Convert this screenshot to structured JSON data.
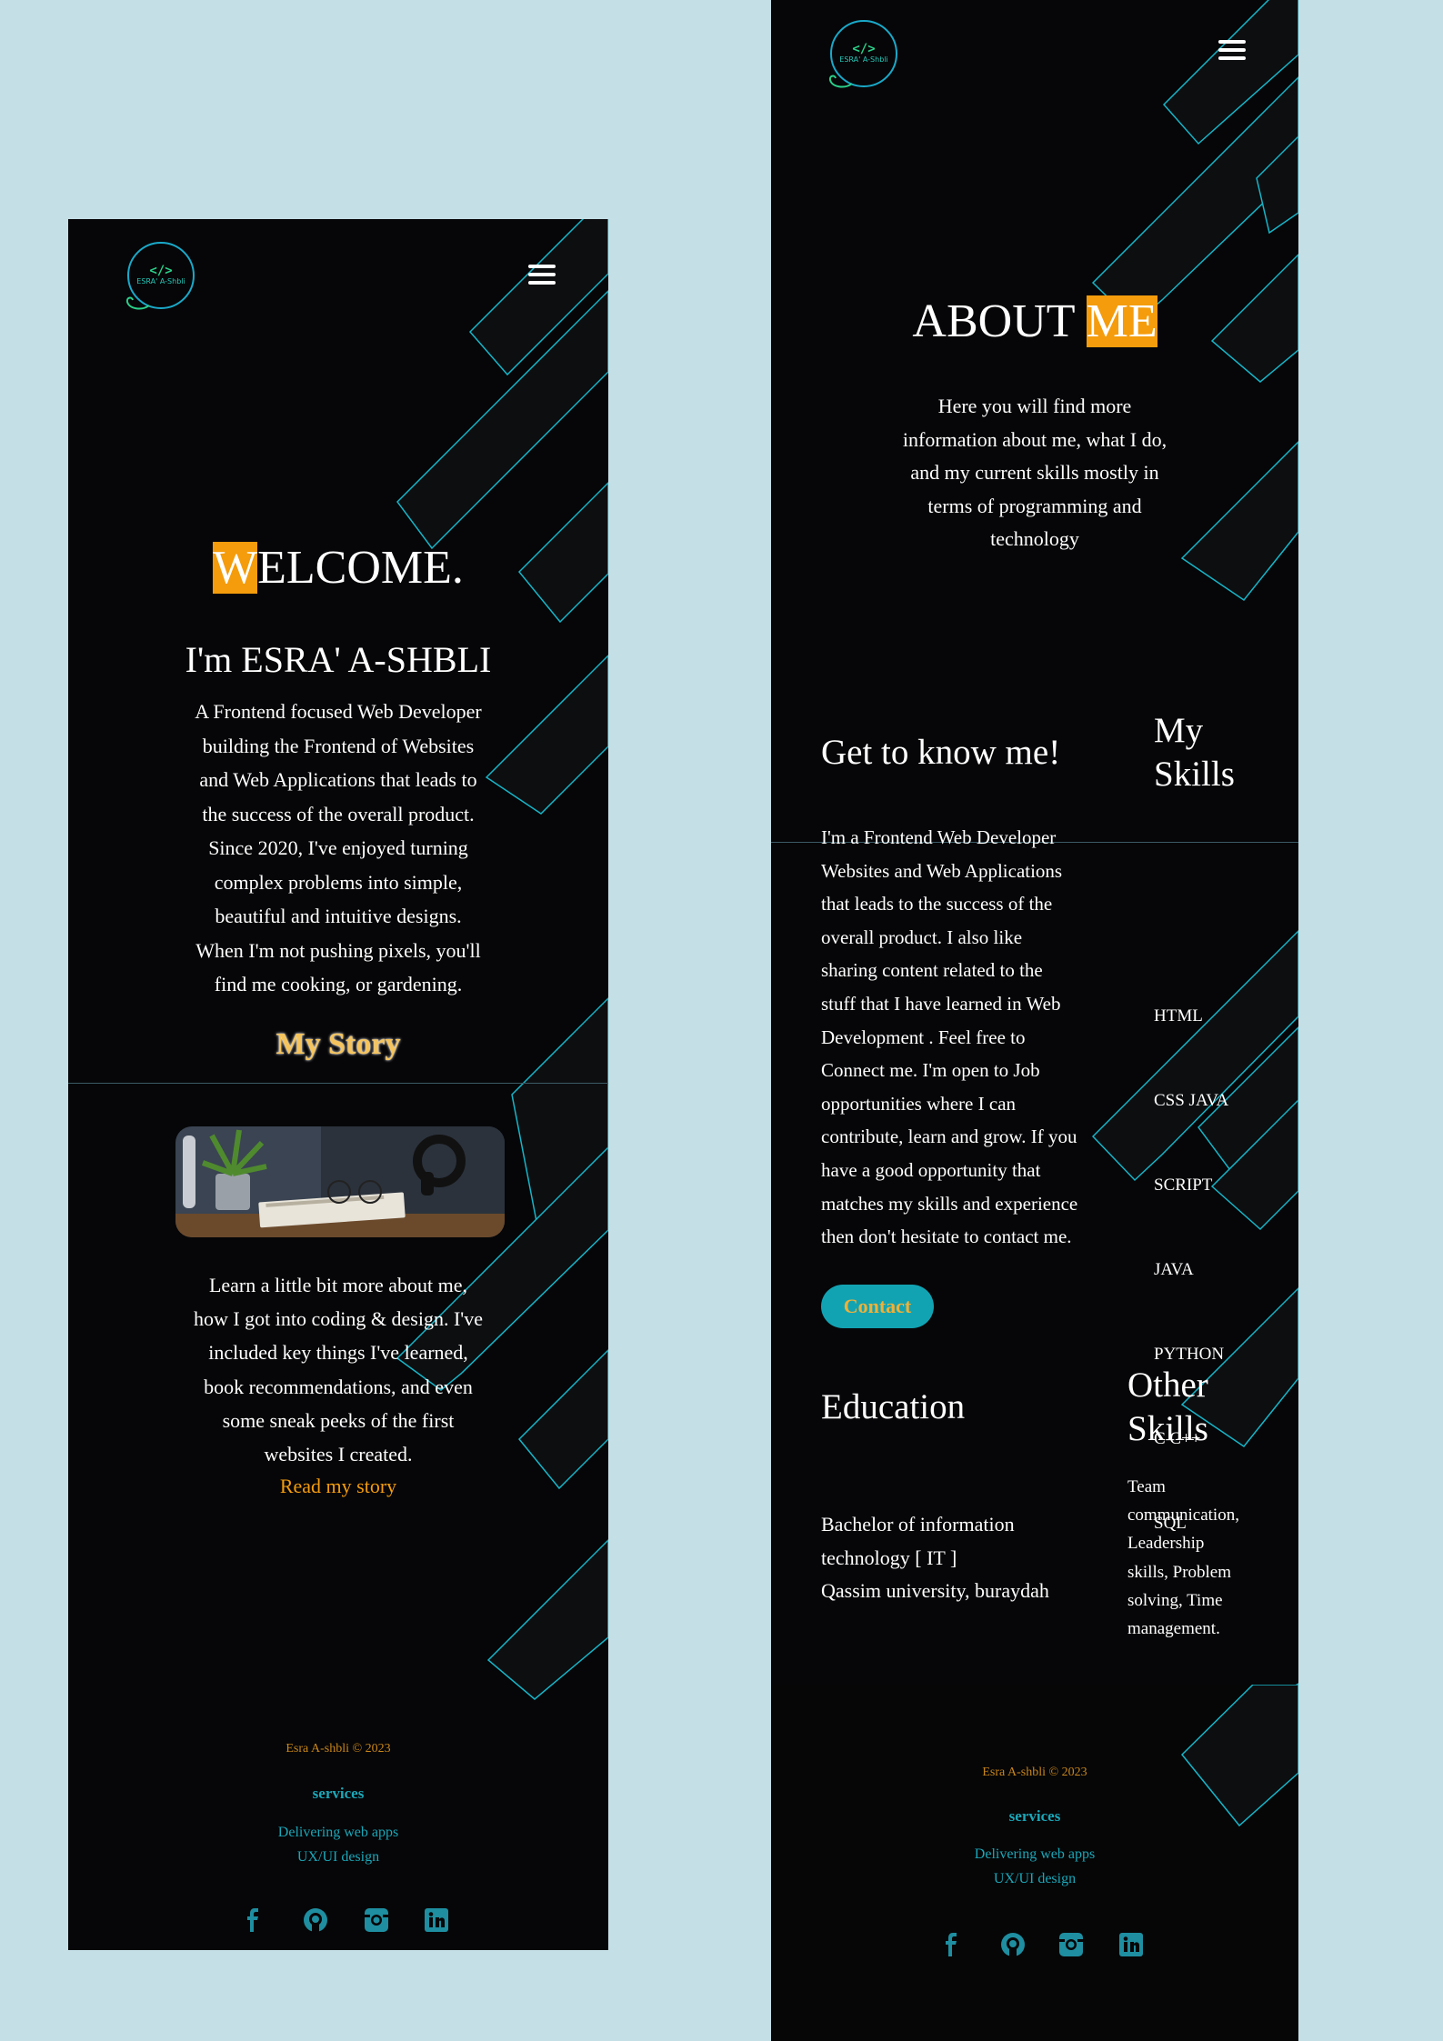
{
  "home": {
    "logo": {
      "code": "</>",
      "text": "ESRA' A-Shbli"
    },
    "welcome_hl": "W",
    "welcome_rest": "ELCOME.",
    "name_heading": "I'm ESRA' A-SHBLI",
    "intro_lines": [
      "A Frontend focused Web Developer",
      "building the Frontend of Websites",
      "and Web Applications that leads to",
      "the success of the overall product.",
      "Since 2020, I've enjoyed turning",
      "complex problems into simple,",
      "beautiful and intuitive designs.",
      "When I'm not pushing pixels, you'll",
      "find me cooking, or gardening."
    ],
    "story_heading": "My Story",
    "story_lines": [
      "Learn a little bit more about me,",
      "how I got into coding & design. I've",
      "included key things I've learned,",
      "book recommendations, and even",
      "some sneak peeks of the first",
      "websites I created."
    ],
    "read_story_link": "Read my story",
    "footer": {
      "copyright": "Esra A-shbli © 2023",
      "services_title": "services",
      "services": [
        "Delivering web apps",
        "UX/UI design"
      ]
    }
  },
  "about": {
    "title_plain": "ABOUT",
    "title_hl": "ME",
    "subtitle_lines": [
      "Here you will find more",
      "information about me, what I do,",
      "and my current skills mostly in",
      "terms of programming and",
      "technology"
    ],
    "get_to_know_heading": "Get to know me!",
    "bio_lines": [
      "I'm a Frontend Web Developer",
      "Websites and Web Applications",
      "that leads to the success of the",
      "overall product. I also like",
      "sharing content related to the",
      "stuff that I have learned in Web",
      "Development . Feel free to",
      "Connect me. I'm open to Job",
      "opportunities where I can",
      "contribute, learn and grow. If you",
      "have a good opportunity that",
      "matches my skills and experience",
      "then don't hesitate to contact me."
    ],
    "skills_heading_1": "My",
    "skills_heading_2": "Skills",
    "skills_lines": [
      "HTML",
      "CSS JAVA",
      "SCRIPT",
      "JAVA",
      "PYTHON",
      "C C++",
      "SQL"
    ],
    "contact_button": "Contact",
    "education_heading": "Education",
    "education_lines": [
      "Bachelor of information",
      "technology [ IT ]",
      "Qassim university, buraydah"
    ],
    "other_skills_heading_1": "Other",
    "other_skills_heading_2": "Skills",
    "other_skills_lines": [
      "Team",
      "communication,",
      "Leadership",
      "skills, Problem",
      "solving, Time",
      "management."
    ],
    "footer": {
      "copyright": "Esra A-shbli © 2023",
      "services_title": "services",
      "services": [
        "Delivering web apps",
        "UX/UI design"
      ]
    }
  },
  "icons": [
    "menu-icon",
    "facebook-icon",
    "github-icon",
    "instagram-icon",
    "linkedin-icon"
  ],
  "colors": {
    "background": "#c5dfe6",
    "page": "#060608",
    "accent": "#f49c0c",
    "teal": "#1aa7b8"
  }
}
